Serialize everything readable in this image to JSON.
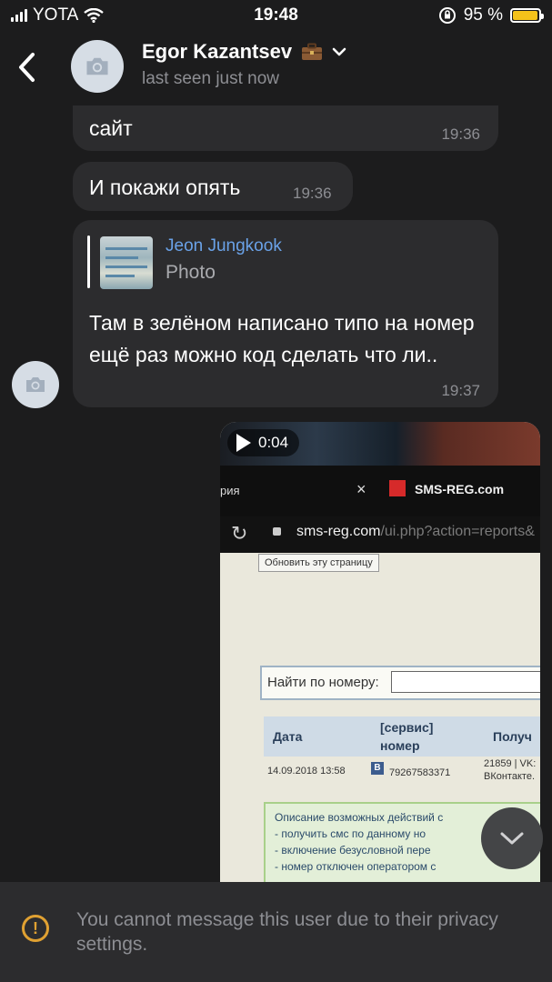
{
  "status_bar": {
    "carrier": "YOTA",
    "time": "19:48",
    "battery_percent": "95 %",
    "battery_level": 0.95,
    "battery_color": "#f4c21a"
  },
  "header": {
    "contact_name": "Egor Kazantsev",
    "status": "last seen just now",
    "name_emoji_icon": "briefcase-icon",
    "expand_icon": "chevron-down-icon"
  },
  "messages": [
    {
      "text": "сайт",
      "time": "19:36"
    },
    {
      "text": "И покажи опять",
      "time": "19:36"
    },
    {
      "reply_to": {
        "name": "Jeon Jungkook",
        "preview": "Photo"
      },
      "text": "Там в зелёном написано типо на номер ещё раз можно код сделать что ли..",
      "time": "19:37"
    }
  ],
  "video_message": {
    "duration": "0:04",
    "browser": {
      "tab_partial": "рия",
      "tab_close": "×",
      "tab_title": "SMS-REG.com",
      "url_host": "sms-reg.com",
      "url_path": "/ui.php?action=reports&",
      "reload_tooltip": "Обновить эту страницу"
    },
    "page": {
      "search_label": "Найти по номеру:",
      "table_headers": [
        "Дата",
        "[сервис]",
        "номер",
        "Получ"
      ],
      "row": {
        "date": "14.09.2018 13:58",
        "service_badge": "B",
        "number": "79267583371",
        "extra_1": "21859 | VK:",
        "extra_2": "ВКонтакте."
      },
      "notes": [
        "Описание возможных действий с",
        "- получить смс по данному но",
        "- включение безусловной пере",
        "- номер отключен оператором с"
      ]
    }
  },
  "notice": {
    "text": "You cannot message this user due to their privacy settings.",
    "icon": "warning-icon",
    "accent": "#e0a132"
  },
  "colors": {
    "background": "#1c1c1d",
    "bubble": "#2c2c2e",
    "reply_name": "#6aa2e8",
    "secondary_text": "#8d8e93"
  }
}
